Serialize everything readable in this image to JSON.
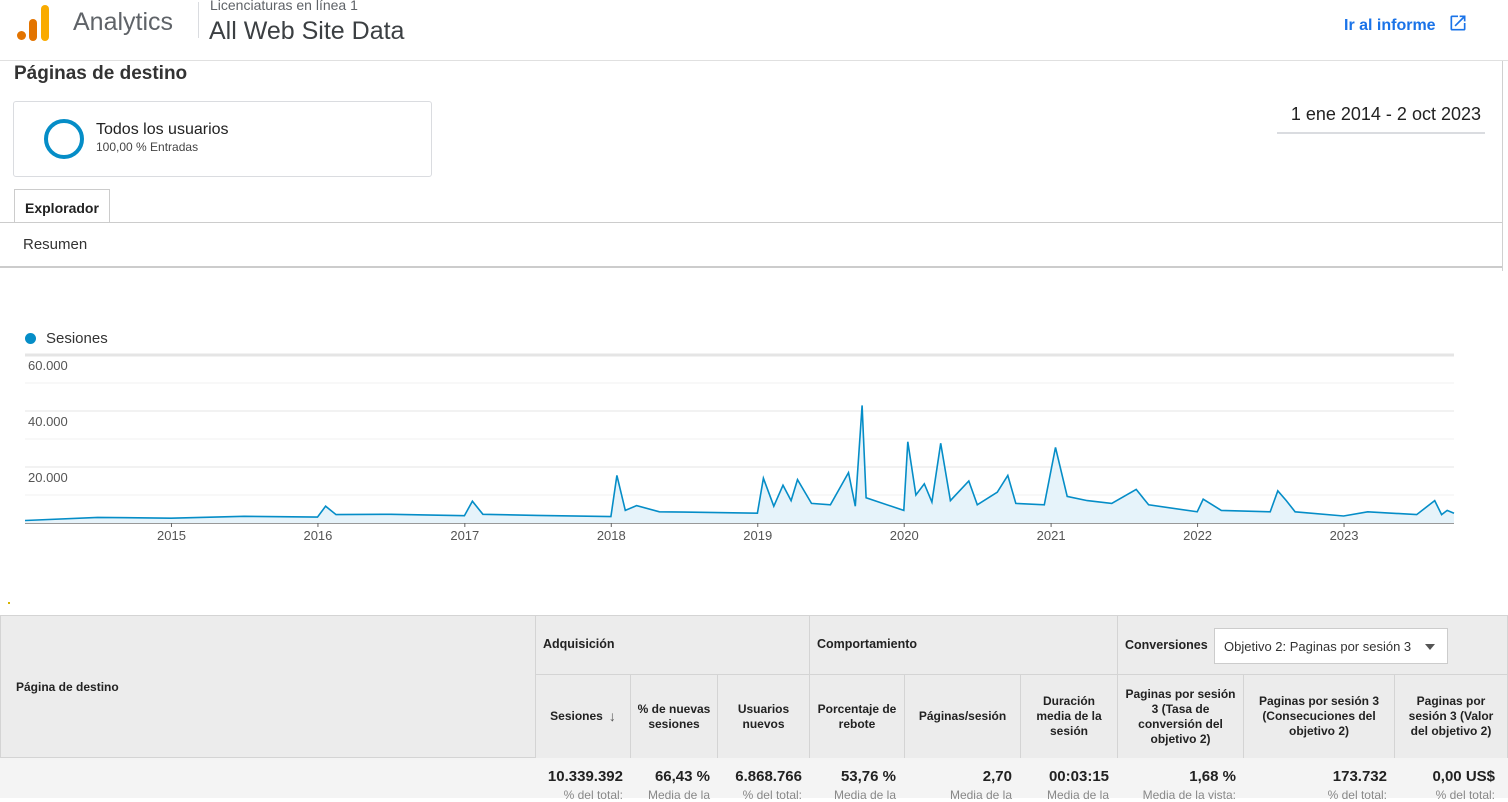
{
  "header": {
    "app_name": "Analytics",
    "account_name": "Licenciaturas en línea 1",
    "view_name": "All Web Site Data",
    "goto_report": "Ir al informe"
  },
  "page": {
    "title": "Páginas de destino",
    "date_range": "1 ene 2014 - 2 oct 2023"
  },
  "segment": {
    "name": "Todos los usuarios",
    "sub": "100,00 % Entradas"
  },
  "tabs": {
    "explorer": "Explorador",
    "summary": "Resumen"
  },
  "chart_data": {
    "type": "line",
    "series": [
      {
        "name": "Sesiones",
        "color": "#058dc7"
      }
    ],
    "x_tick_labels": [
      "2015",
      "2016",
      "2017",
      "2018",
      "2019",
      "2020",
      "2021",
      "2022",
      "2023"
    ],
    "y_tick_labels": [
      "60.000",
      "40.000",
      "20.000"
    ],
    "ylim": [
      0,
      60000
    ],
    "x_range": [
      "2014-01-01",
      "2023-10-02"
    ],
    "points": [
      [
        "2014-01-01",
        900
      ],
      [
        "2014-07-01",
        2000
      ],
      [
        "2014-12-31",
        1700
      ],
      [
        "2015-07-01",
        2400
      ],
      [
        "2015-12-31",
        2100
      ],
      [
        "2016-01-20",
        6000
      ],
      [
        "2016-02-15",
        3000
      ],
      [
        "2016-07-01",
        3100
      ],
      [
        "2016-12-31",
        2600
      ],
      [
        "2017-01-20",
        7800
      ],
      [
        "2017-02-15",
        3100
      ],
      [
        "2017-07-01",
        2700
      ],
      [
        "2017-12-31",
        2300
      ],
      [
        "2018-01-15",
        17000
      ],
      [
        "2018-02-05",
        4500
      ],
      [
        "2018-03-05",
        6200
      ],
      [
        "2018-05-01",
        4000
      ],
      [
        "2018-07-01",
        3900
      ],
      [
        "2018-12-31",
        3500
      ],
      [
        "2019-01-15",
        16000
      ],
      [
        "2019-02-10",
        6000
      ],
      [
        "2019-03-05",
        13500
      ],
      [
        "2019-03-25",
        8000
      ],
      [
        "2019-04-10",
        15500
      ],
      [
        "2019-05-15",
        7000
      ],
      [
        "2019-07-01",
        6500
      ],
      [
        "2019-08-15",
        18000
      ],
      [
        "2019-09-01",
        6000
      ],
      [
        "2019-09-18",
        42000
      ],
      [
        "2019-09-28",
        9000
      ],
      [
        "2019-12-31",
        4500
      ],
      [
        "2020-01-10",
        29000
      ],
      [
        "2020-01-30",
        10000
      ],
      [
        "2020-02-20",
        14000
      ],
      [
        "2020-03-10",
        7500
      ],
      [
        "2020-04-01",
        28500
      ],
      [
        "2020-04-25",
        8000
      ],
      [
        "2020-06-10",
        15000
      ],
      [
        "2020-07-01",
        6500
      ],
      [
        "2020-08-20",
        11000
      ],
      [
        "2020-09-15",
        17000
      ],
      [
        "2020-10-05",
        7000
      ],
      [
        "2020-12-15",
        6500
      ],
      [
        "2021-01-12",
        27000
      ],
      [
        "2021-02-10",
        9500
      ],
      [
        "2021-04-01",
        8000
      ],
      [
        "2021-06-01",
        7000
      ],
      [
        "2021-08-01",
        12000
      ],
      [
        "2021-09-01",
        6500
      ],
      [
        "2021-12-31",
        4000
      ],
      [
        "2022-01-15",
        8500
      ],
      [
        "2022-03-01",
        4500
      ],
      [
        "2022-07-01",
        4000
      ],
      [
        "2022-07-20",
        11500
      ],
      [
        "2022-08-10",
        8000
      ],
      [
        "2022-09-01",
        4000
      ],
      [
        "2022-12-31",
        2500
      ],
      [
        "2023-03-01",
        4000
      ],
      [
        "2023-07-01",
        3000
      ],
      [
        "2023-08-15",
        8000
      ],
      [
        "2023-09-01",
        3000
      ],
      [
        "2023-09-15",
        4500
      ],
      [
        "2023-10-02",
        3500
      ]
    ]
  },
  "table": {
    "dimension_header": "Página de destino",
    "groups": {
      "acquisition": "Adquisición",
      "behavior": "Comportamiento",
      "conversions": "Conversiones",
      "goal_select": "Objetivo 2: Paginas por sesión 3"
    },
    "columns": [
      "Sesiones",
      "% de nuevas sesiones",
      "Usuarios nuevos",
      "Porcentaje de rebote",
      "Páginas/sesión",
      "Duración media de la sesión",
      "Paginas por sesión 3 (Tasa de conversión del objetivo 2)",
      "Paginas por sesión 3 (Consecuciones del objetivo 2)",
      "Paginas por sesión 3 (Valor del objetivo 2)"
    ],
    "totals": [
      "10.339.392",
      "66,43 %",
      "6.868.766",
      "53,76 %",
      "2,70",
      "00:03:15",
      "1,68 %",
      "173.732",
      "0,00 US$"
    ],
    "totals_sub": [
      "% del total:",
      "Media de la",
      "% del total:",
      "Media de la",
      "Media de la",
      "Media de la",
      "Media de la vista:",
      "% del total:",
      "% del total:"
    ]
  }
}
